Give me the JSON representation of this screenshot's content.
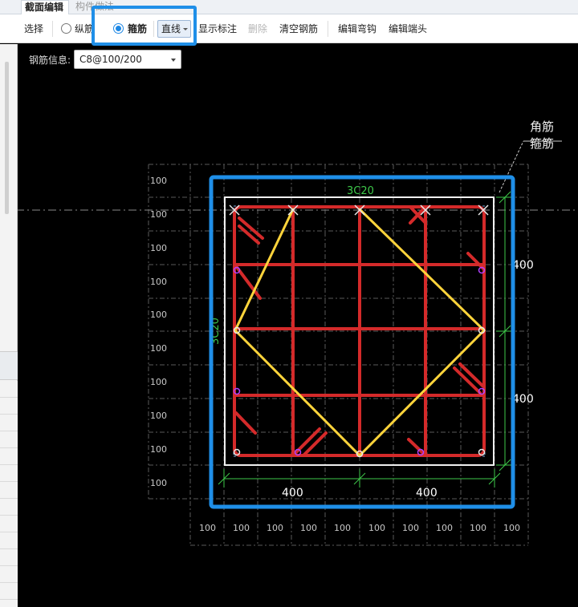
{
  "tabs": {
    "active": "截面编辑",
    "inactive": "构件做法"
  },
  "toolbar": {
    "select": "选择",
    "longitudinal": "纵筋",
    "stirrup": "箍筋",
    "draw_mode": "直线",
    "show_annotation": "显示标注",
    "delete": "删除",
    "clear_rebar": "清空钢筋",
    "edit_hook": "编辑弯钩",
    "edit_end": "编辑端头"
  },
  "rebar_info": {
    "label": "钢筋信息:",
    "value": "C8@100/200"
  },
  "drawing": {
    "callout": [
      "角筋",
      "箍筋"
    ],
    "top_rebar": "3C20",
    "side_rebar": "3C20",
    "bottom_dims": [
      "400",
      "400"
    ],
    "right_dims": [
      "400",
      "400"
    ],
    "grid_x": [
      "100",
      "100",
      "100",
      "100",
      "100",
      "100",
      "100",
      "100",
      "100",
      "100"
    ],
    "grid_y": [
      "100",
      "100",
      "100",
      "100",
      "100",
      "100",
      "100",
      "100",
      "100",
      "100"
    ]
  },
  "colors": {
    "rebar": "#d42a2a",
    "stirrup_selected": "#ffd43b",
    "dimension": "#3ec84a",
    "section_outline": "#ffffff",
    "highlight": "#1f8fe8"
  }
}
